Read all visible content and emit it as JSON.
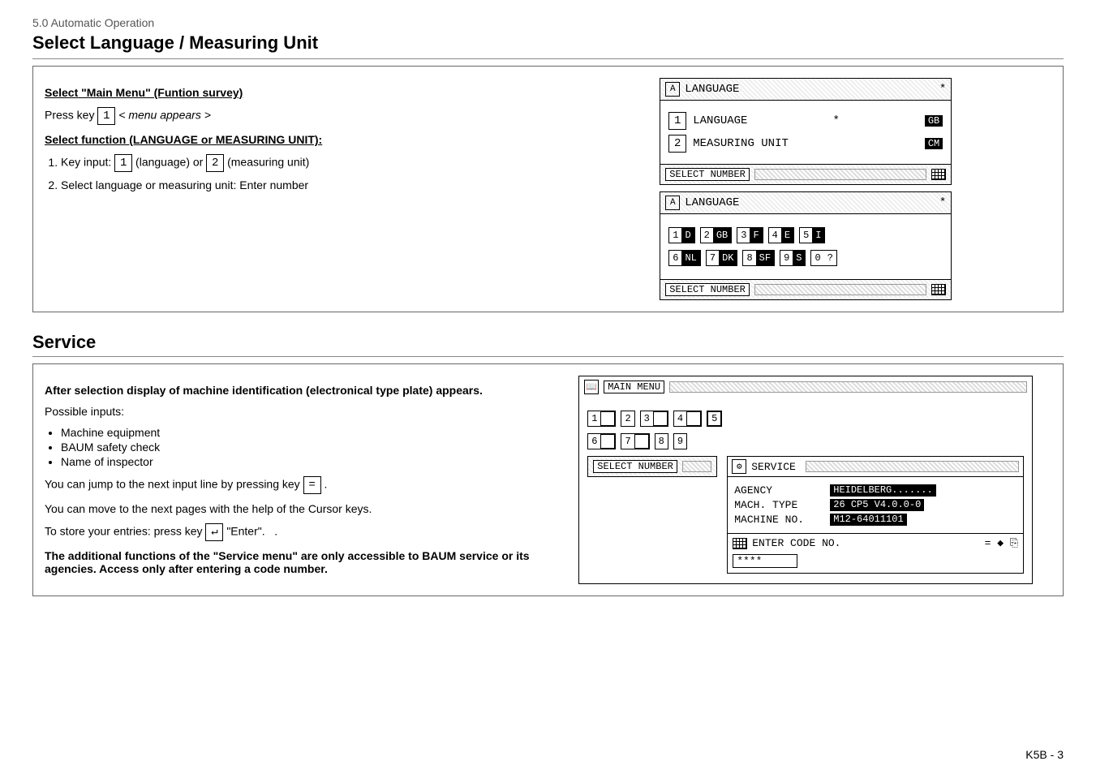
{
  "breadcrumb": "5.0 Automatic Operation",
  "title1": "Select Language / Measuring Unit",
  "sec1": {
    "h_main": "Select \"Main Menu\" (Funtion survey)",
    "press_key_label": "Press key",
    "press_key_num": "1",
    "press_key_after": "< menu appears >",
    "h_func": "Select function (LANGUAGE or MEASURING UNIT):",
    "step1_pre": "Key input:",
    "step1_k1": "1",
    "step1_mid1": "(language) or",
    "step1_k2": "2",
    "step1_mid2": "(measuring unit)",
    "step2": "Select language or measuring unit: Enter number",
    "screenA": {
      "title": "LANGUAGE",
      "asterisk": "*",
      "opt1_num": "1",
      "opt1_label": "LANGUAGE",
      "opt1_badge": "GB",
      "opt2_num": "2",
      "opt2_label": "MEASURING UNIT",
      "opt2_badge": "CM",
      "footer": "SELECT NUMBER"
    },
    "screenB": {
      "title": "LANGUAGE",
      "asterisk": "*",
      "row1": [
        {
          "n": "1",
          "c": "D"
        },
        {
          "n": "2",
          "c": "GB"
        },
        {
          "n": "3",
          "c": "F"
        },
        {
          "n": "4",
          "c": "E"
        },
        {
          "n": "5",
          "c": "I"
        }
      ],
      "row2": [
        {
          "n": "6",
          "c": "NL"
        },
        {
          "n": "7",
          "c": "DK"
        },
        {
          "n": "8",
          "c": "SF"
        },
        {
          "n": "9",
          "c": "S"
        },
        {
          "n": "0",
          "c": "?"
        }
      ],
      "footer": "SELECT NUMBER"
    }
  },
  "title2": "Service",
  "sec2": {
    "intro": "After selection display of machine identification (electronical type plate) appears.",
    "possible": "Possible inputs:",
    "bullets": [
      "Machine equipment",
      "BAUM safety check",
      "Name of inspector"
    ],
    "jump1": "You can jump to the next input line by pressing key",
    "jump_key": "=",
    "jump2": ".",
    "move": "You can move to the next pages with the help of the Cursor keys.",
    "store1": "To store your entries: press key",
    "store_key": "↵",
    "store2": "\"Enter\".",
    "note": "The additional functions of  the \"Service menu\" are only accessible to BAUM service or its agencies. Access only after entering a code number.",
    "mainmenu": {
      "title": "MAIN MENU",
      "tiles_r1": [
        "1",
        "2",
        "3",
        "4",
        "5"
      ],
      "tiles_r2": [
        "6",
        "7",
        "8",
        "9"
      ],
      "footer": "SELECT NUMBER"
    },
    "service": {
      "title": "SERVICE",
      "fields": {
        "agency_lbl": "AGENCY",
        "agency_val": "HEIDELBERG.......",
        "type_lbl": "MACH. TYPE",
        "type_val": "26  CP5 V4.0.0-0",
        "no_lbl": "MACHINE NO.",
        "no_val": "M12-64011101"
      },
      "enter": "ENTER CODE NO.",
      "code": "****"
    }
  },
  "page": "K5B - 3"
}
